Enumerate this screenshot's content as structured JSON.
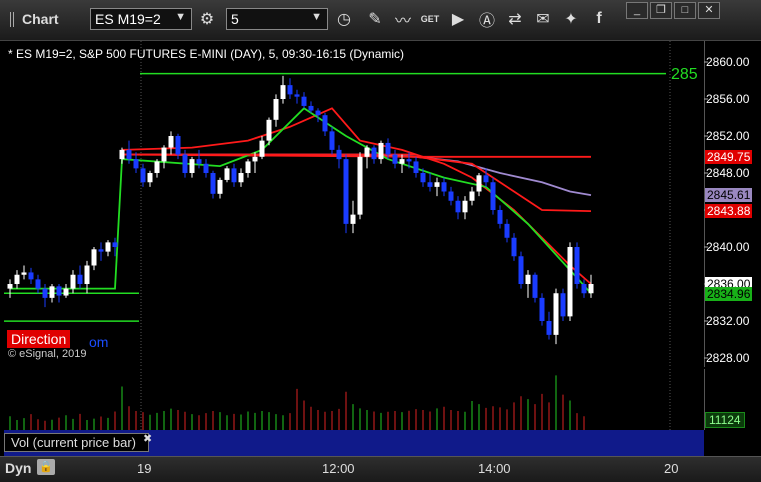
{
  "toolbar": {
    "app_title": "Chart",
    "symbol": "ES M19=2",
    "interval": "5"
  },
  "chart": {
    "title": "* ES M19=2, S&P 500 FUTURES E-MINI (DAY), 5, 09:30-16:15 (Dynamic)",
    "copyright": "© eSignal, 2019",
    "direction_label": "Direction",
    "direction_tail": "om",
    "green_line_label": "285",
    "price_ticks": [
      "2860.00",
      "2856.00",
      "2852.00",
      "2848.00",
      "2844.00",
      "2840.00",
      "2836.00",
      "2832.00",
      "2828.00"
    ],
    "price_tags": [
      {
        "text": "2849.75",
        "bg": "#e00000",
        "fg": "#ffffff"
      },
      {
        "text": "2845.61",
        "bg": "#9a88c0",
        "fg": "#000000"
      },
      {
        "text": "2843.88",
        "bg": "#e00000",
        "fg": "#ffffff"
      },
      {
        "text": "2836.00",
        "bg": "#ffffff",
        "fg": "#000000"
      },
      {
        "text": "2834.96",
        "bg": "#18b018",
        "fg": "#000000"
      }
    ],
    "colors": {
      "up": "#ffffff",
      "down": "#1a3cff",
      "ma_red": "#ff1a1a",
      "ma_purple": "#a08ad0",
      "ma_green": "#22dd22"
    }
  },
  "volume": {
    "study_label": "Vol (current price bar)",
    "last_value": "11124"
  },
  "time_axis": {
    "mode": "Dyn",
    "labels": [
      "19",
      "12:00",
      "14:00",
      "20"
    ]
  },
  "chart_data": {
    "type": "candlestick",
    "title": "* ES M19=2, S&P 500 FUTURES E-MINI (DAY), 5, 09:30-16:15 (Dynamic)",
    "ylim": [
      2827,
      2861
    ],
    "candles": [
      {
        "o": 2835.5,
        "h": 2836.5,
        "l": 2834.5,
        "c": 2836
      },
      {
        "o": 2836,
        "h": 2837.5,
        "l": 2835.5,
        "c": 2837
      },
      {
        "o": 2837,
        "h": 2838,
        "l": 2836.5,
        "c": 2837.25
      },
      {
        "o": 2837.25,
        "h": 2837.75,
        "l": 2836,
        "c": 2836.5
      },
      {
        "o": 2836.5,
        "h": 2837,
        "l": 2835,
        "c": 2835.5
      },
      {
        "o": 2835.5,
        "h": 2836,
        "l": 2833.5,
        "c": 2834.5
      },
      {
        "o": 2834.5,
        "h": 2836,
        "l": 2834,
        "c": 2835.75
      },
      {
        "o": 2835.75,
        "h": 2836,
        "l": 2834,
        "c": 2834.75
      },
      {
        "o": 2834.75,
        "h": 2836,
        "l": 2834.5,
        "c": 2835.5
      },
      {
        "o": 2835.5,
        "h": 2837.5,
        "l": 2835,
        "c": 2837
      },
      {
        "o": 2837,
        "h": 2838,
        "l": 2835.5,
        "c": 2836
      },
      {
        "o": 2836,
        "h": 2838.5,
        "l": 2835,
        "c": 2838
      },
      {
        "o": 2838,
        "h": 2840,
        "l": 2837.5,
        "c": 2839.75
      },
      {
        "o": 2839.75,
        "h": 2840.5,
        "l": 2838.5,
        "c": 2839.5
      },
      {
        "o": 2839.5,
        "h": 2840.75,
        "l": 2839,
        "c": 2840.5
      },
      {
        "o": 2840.5,
        "h": 2841,
        "l": 2839,
        "c": 2840
      },
      {
        "o": 2849.5,
        "h": 2850.75,
        "l": 2849,
        "c": 2850.5
      },
      {
        "o": 2850.5,
        "h": 2851.5,
        "l": 2849,
        "c": 2849.5
      },
      {
        "o": 2849.5,
        "h": 2850.25,
        "l": 2848,
        "c": 2848.5
      },
      {
        "o": 2848.5,
        "h": 2849,
        "l": 2846.5,
        "c": 2847
      },
      {
        "o": 2847,
        "h": 2848.25,
        "l": 2846.5,
        "c": 2848
      },
      {
        "o": 2848,
        "h": 2849.5,
        "l": 2847.5,
        "c": 2849.25
      },
      {
        "o": 2849.25,
        "h": 2851,
        "l": 2848.5,
        "c": 2850.75
      },
      {
        "o": 2850.75,
        "h": 2852.5,
        "l": 2850,
        "c": 2852
      },
      {
        "o": 2852,
        "h": 2852.25,
        "l": 2849.5,
        "c": 2850
      },
      {
        "o": 2850,
        "h": 2850.5,
        "l": 2847.5,
        "c": 2848
      },
      {
        "o": 2848,
        "h": 2849.75,
        "l": 2847.5,
        "c": 2849.5
      },
      {
        "o": 2849.5,
        "h": 2850.5,
        "l": 2848.5,
        "c": 2849
      },
      {
        "o": 2849,
        "h": 2849.5,
        "l": 2847.5,
        "c": 2848
      },
      {
        "o": 2848,
        "h": 2848.25,
        "l": 2845.25,
        "c": 2845.75
      },
      {
        "o": 2845.75,
        "h": 2847.5,
        "l": 2845.25,
        "c": 2847.25
      },
      {
        "o": 2847.25,
        "h": 2848.75,
        "l": 2847,
        "c": 2848.5
      },
      {
        "o": 2848.5,
        "h": 2849,
        "l": 2846.5,
        "c": 2847
      },
      {
        "o": 2847,
        "h": 2848.5,
        "l": 2846.5,
        "c": 2848
      },
      {
        "o": 2848,
        "h": 2849.5,
        "l": 2847.5,
        "c": 2849.25
      },
      {
        "o": 2849.25,
        "h": 2850.25,
        "l": 2848,
        "c": 2849.75
      },
      {
        "o": 2849.75,
        "h": 2852,
        "l": 2849.5,
        "c": 2851.5
      },
      {
        "o": 2851.5,
        "h": 2854,
        "l": 2851,
        "c": 2853.75
      },
      {
        "o": 2853.75,
        "h": 2856.5,
        "l": 2853,
        "c": 2856
      },
      {
        "o": 2856,
        "h": 2858.5,
        "l": 2855.5,
        "c": 2857.5
      },
      {
        "o": 2857.5,
        "h": 2858.25,
        "l": 2856,
        "c": 2856.5
      },
      {
        "o": 2856.5,
        "h": 2857,
        "l": 2855.5,
        "c": 2856.25
      },
      {
        "o": 2856.25,
        "h": 2856.75,
        "l": 2855,
        "c": 2855.25
      },
      {
        "o": 2855.25,
        "h": 2855.75,
        "l": 2854.5,
        "c": 2854.75
      },
      {
        "o": 2854.75,
        "h": 2855,
        "l": 2853.5,
        "c": 2854.25
      },
      {
        "o": 2854.25,
        "h": 2854.5,
        "l": 2852,
        "c": 2852.5
      },
      {
        "o": 2852.5,
        "h": 2853,
        "l": 2850,
        "c": 2850.5
      },
      {
        "o": 2850.5,
        "h": 2851,
        "l": 2848.5,
        "c": 2849.5
      },
      {
        "o": 2849.5,
        "h": 2850,
        "l": 2841.5,
        "c": 2842.5
      },
      {
        "o": 2842.5,
        "h": 2845,
        "l": 2841.5,
        "c": 2843.5
      },
      {
        "o": 2843.5,
        "h": 2850.25,
        "l": 2843,
        "c": 2849.75
      },
      {
        "o": 2849.75,
        "h": 2851,
        "l": 2848.5,
        "c": 2850.75
      },
      {
        "o": 2850.75,
        "h": 2851,
        "l": 2849,
        "c": 2849.5
      },
      {
        "o": 2849.5,
        "h": 2851.5,
        "l": 2849,
        "c": 2851.25
      },
      {
        "o": 2851.25,
        "h": 2851.75,
        "l": 2849.5,
        "c": 2850
      },
      {
        "o": 2850,
        "h": 2850.5,
        "l": 2848.5,
        "c": 2849
      },
      {
        "o": 2849,
        "h": 2850,
        "l": 2848,
        "c": 2849.5
      },
      {
        "o": 2849.5,
        "h": 2850.25,
        "l": 2848.5,
        "c": 2849.25
      },
      {
        "o": 2849.25,
        "h": 2849.75,
        "l": 2847.5,
        "c": 2848
      },
      {
        "o": 2848,
        "h": 2848.5,
        "l": 2846.5,
        "c": 2847
      },
      {
        "o": 2847,
        "h": 2848,
        "l": 2846,
        "c": 2846.5
      },
      {
        "o": 2846.5,
        "h": 2847.5,
        "l": 2845.5,
        "c": 2847
      },
      {
        "o": 2847,
        "h": 2847.5,
        "l": 2845.5,
        "c": 2846
      },
      {
        "o": 2846,
        "h": 2846.5,
        "l": 2844.5,
        "c": 2845
      },
      {
        "o": 2845,
        "h": 2845.5,
        "l": 2843,
        "c": 2843.75
      },
      {
        "o": 2843.75,
        "h": 2845.5,
        "l": 2843,
        "c": 2845
      },
      {
        "o": 2845,
        "h": 2846.5,
        "l": 2844.5,
        "c": 2846
      },
      {
        "o": 2846,
        "h": 2848,
        "l": 2845.5,
        "c": 2847.75
      },
      {
        "o": 2847.75,
        "h": 2848.5,
        "l": 2846.5,
        "c": 2847
      },
      {
        "o": 2847,
        "h": 2847.5,
        "l": 2843.5,
        "c": 2844
      },
      {
        "o": 2844,
        "h": 2844.5,
        "l": 2842,
        "c": 2842.5
      },
      {
        "o": 2842.5,
        "h": 2843,
        "l": 2840.5,
        "c": 2841
      },
      {
        "o": 2841,
        "h": 2841.5,
        "l": 2838.5,
        "c": 2839
      },
      {
        "o": 2839,
        "h": 2839.5,
        "l": 2835.5,
        "c": 2836
      },
      {
        "o": 2836,
        "h": 2837.5,
        "l": 2834.5,
        "c": 2837
      },
      {
        "o": 2837,
        "h": 2837.25,
        "l": 2834,
        "c": 2834.5
      },
      {
        "o": 2834.5,
        "h": 2835,
        "l": 2831.5,
        "c": 2832
      },
      {
        "o": 2832,
        "h": 2833,
        "l": 2830,
        "c": 2830.5
      },
      {
        "o": 2830.5,
        "h": 2835.5,
        "l": 2829.5,
        "c": 2835
      },
      {
        "o": 2835,
        "h": 2835.5,
        "l": 2832,
        "c": 2832.5
      },
      {
        "o": 2832.5,
        "h": 2840.5,
        "l": 2832,
        "c": 2840
      },
      {
        "o": 2840,
        "h": 2840.5,
        "l": 2835.5,
        "c": 2836
      },
      {
        "o": 2836,
        "h": 2836.5,
        "l": 2834.5,
        "c": 2835
      },
      {
        "o": 2835,
        "h": 2837,
        "l": 2834.5,
        "c": 2836
      }
    ],
    "ma_red_fast": [
      [
        16,
        2850.5
      ],
      [
        26,
        2850.75
      ],
      [
        34,
        2851.5
      ],
      [
        40,
        2853
      ],
      [
        46,
        2855
      ],
      [
        50,
        2851.5
      ],
      [
        56,
        2850.5
      ],
      [
        62,
        2849
      ],
      [
        66,
        2847.5
      ],
      [
        72,
        2844
      ],
      [
        76,
        2841
      ],
      [
        80,
        2838
      ],
      [
        83,
        2836
      ]
    ],
    "ma_green": [
      [
        0,
        2835.5
      ],
      [
        15,
        2835.5
      ],
      [
        16,
        2849.5
      ],
      [
        30,
        2848.75
      ],
      [
        36,
        2850.5
      ],
      [
        42,
        2855
      ],
      [
        48,
        2852
      ],
      [
        54,
        2849.5
      ],
      [
        62,
        2847.5
      ],
      [
        68,
        2846.5
      ],
      [
        74,
        2842.5
      ],
      [
        80,
        2837.5
      ],
      [
        83,
        2835
      ]
    ],
    "ma_purple": [
      [
        16,
        2850
      ],
      [
        50,
        2850
      ],
      [
        58,
        2849.75
      ],
      [
        64,
        2849.25
      ],
      [
        70,
        2848
      ],
      [
        76,
        2847
      ],
      [
        80,
        2846
      ],
      [
        83,
        2845.61
      ]
    ],
    "ma_red_slow": [
      [
        16,
        2850
      ],
      [
        58,
        2849.75
      ],
      [
        66,
        2849
      ],
      [
        72,
        2846
      ],
      [
        76,
        2844
      ],
      [
        83,
        2843.88
      ]
    ],
    "flat_red": [
      [
        58,
        2849.75
      ],
      [
        83,
        2849.75
      ]
    ],
    "green_hline": 2858.75,
    "prev_session_green": [
      [
        0,
        2835
      ],
      [
        15,
        2835
      ]
    ],
    "volume": [
      520,
      380,
      450,
      600,
      410,
      350,
      390,
      470,
      560,
      420,
      610,
      380,
      430,
      510,
      460,
      700,
      1650,
      900,
      720,
      680,
      580,
      650,
      720,
      810,
      760,
      690,
      600,
      560,
      640,
      720,
      680,
      560,
      610,
      590,
      700,
      650,
      720,
      680,
      600,
      560,
      640,
      1560,
      1120,
      880,
      760,
      690,
      720,
      800,
      1450,
      980,
      820,
      760,
      700,
      650,
      690,
      720,
      680,
      730,
      790,
      760,
      700,
      820,
      880,
      760,
      720,
      690,
      1100,
      980,
      840,
      900,
      860,
      780,
      1050,
      1280,
      1170,
      980,
      1370,
      1050,
      2070,
      1340,
      1120,
      640,
      520
    ]
  }
}
